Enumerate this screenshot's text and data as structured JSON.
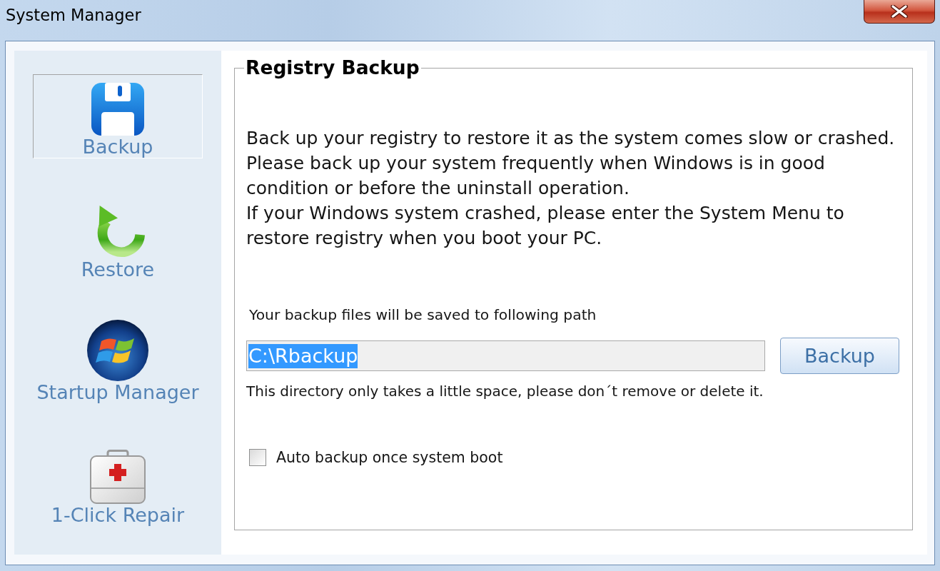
{
  "window": {
    "title": "System Manager"
  },
  "sidebar": {
    "items": [
      {
        "label": "Backup",
        "selected": true
      },
      {
        "label": "Restore",
        "selected": false
      },
      {
        "label": "Startup Manager",
        "selected": false
      },
      {
        "label": "1-Click Repair",
        "selected": false
      }
    ]
  },
  "panel": {
    "title": "Registry Backup",
    "paragraphs": [
      "Back up your registry to restore it as the system comes slow or crashed.",
      "Please back up your system frequently when Windows is in good\ncondition or before the uninstall operation.",
      "If your Windows system crashed, please enter the System Menu to\nrestore registry when you boot your PC."
    ],
    "path_label": "Your backup files will be saved to following path",
    "path_field": {
      "value": "C:\\Rbackup",
      "selected": true
    },
    "backup_button": "Backup",
    "note": "This directory only takes a little space, please don´t remove or delete it.",
    "auto_backup": {
      "label": "Auto backup once system boot",
      "checked": false
    }
  }
}
